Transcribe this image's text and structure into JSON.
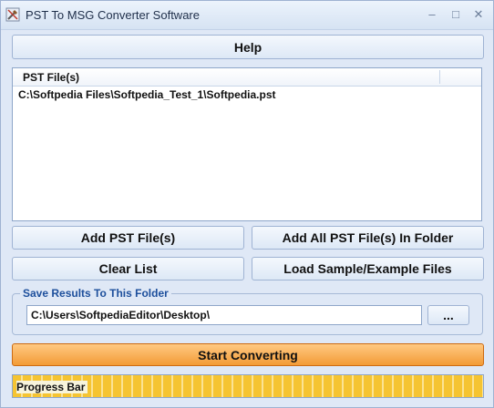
{
  "window": {
    "title": "PST To MSG Converter Software",
    "controls": {
      "minimize": "–",
      "maximize": "□",
      "close": "✕"
    }
  },
  "help_button": {
    "label": "Help"
  },
  "file_list": {
    "column_header": "PST File(s)",
    "items": [
      "C:\\Softpedia Files\\Softpedia_Test_1\\Softpedia.pst"
    ]
  },
  "buttons": {
    "add_files": "Add PST File(s)",
    "add_folder": "Add All PST File(s) In Folder",
    "clear_list": "Clear List",
    "load_sample": "Load Sample/Example Files",
    "browse": "...",
    "start": "Start Converting"
  },
  "output_folder": {
    "label": "Save Results To This Folder",
    "value": "C:\\Users\\SoftpediaEditor\\Desktop\\"
  },
  "progress": {
    "label": "Progress Bar",
    "fraction": 1.0
  },
  "icons": {
    "app": "tools-app-icon",
    "minimize": "minimize-icon",
    "maximize": "maximize-icon",
    "close": "close-icon"
  },
  "colors": {
    "accent": "#f39b36",
    "progress_fill": "#f5c432",
    "group_label": "#1d4f9c"
  }
}
